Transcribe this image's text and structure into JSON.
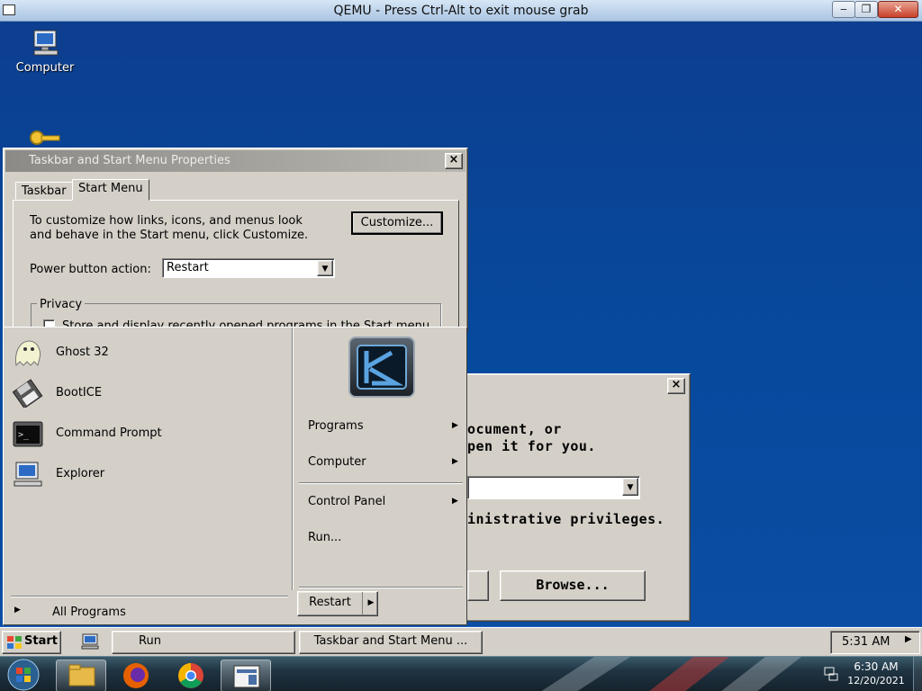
{
  "host_window": {
    "title": "QEMU - Press Ctrl-Alt to exit mouse grab",
    "min_label": "‒",
    "max_label": "❐",
    "close_label": "✕"
  },
  "desktop": {
    "icons": [
      {
        "label": "Computer",
        "icon": "computer-icon"
      }
    ]
  },
  "run_dialog": {
    "close_label": "×",
    "text_line1": "ocument, or",
    "text_line2": "pen it for you.",
    "text_line3": "inistrative privileges.",
    "browse_label": "Browse..."
  },
  "taskbar_props": {
    "title": "Taskbar and Start Menu Properties",
    "close_label": "×",
    "tabs": [
      "Taskbar",
      "Start Menu"
    ],
    "active_tab": "Start Menu",
    "description": "To customize how links, icons, and menus look and behave in the Start menu, click Customize.",
    "customize_label": "Customize...",
    "power_label": "Power button action:",
    "power_value": "Restart",
    "privacy_label": "Privacy",
    "privacy_item": "Store and display recently opened programs in the Start menu"
  },
  "start_menu": {
    "left_items": [
      {
        "label": "Ghost 32",
        "icon": "ghost-icon"
      },
      {
        "label": "BootICE",
        "icon": "bootice-icon"
      },
      {
        "label": "Command Prompt",
        "icon": "command-prompt-icon"
      },
      {
        "label": "Explorer",
        "icon": "explorer-icon"
      }
    ],
    "all_programs": "All Programs",
    "right_items": [
      {
        "label": "Programs",
        "submenu": true
      },
      {
        "label": "Computer",
        "submenu": true
      },
      {
        "label": "Control Panel",
        "submenu": true
      },
      {
        "label": "Run...",
        "submenu": false
      }
    ],
    "power_button": "Restart"
  },
  "taskbar": {
    "start_label": "Start",
    "buttons": [
      "Run",
      "Taskbar and Start Menu ..."
    ],
    "clock": "5:31 AM"
  },
  "host_taskbar": {
    "apps": [
      "start-orb-icon",
      "file-explorer-icon",
      "firefox-icon",
      "chrome-icon",
      "qemu-icon"
    ],
    "time": "6:30 AM",
    "date": "12/20/2021"
  },
  "colors": {
    "desktop_blue": "#0a4da2",
    "classic_gray": "#d4d0c8",
    "inactive_title": "#8c8a86"
  }
}
